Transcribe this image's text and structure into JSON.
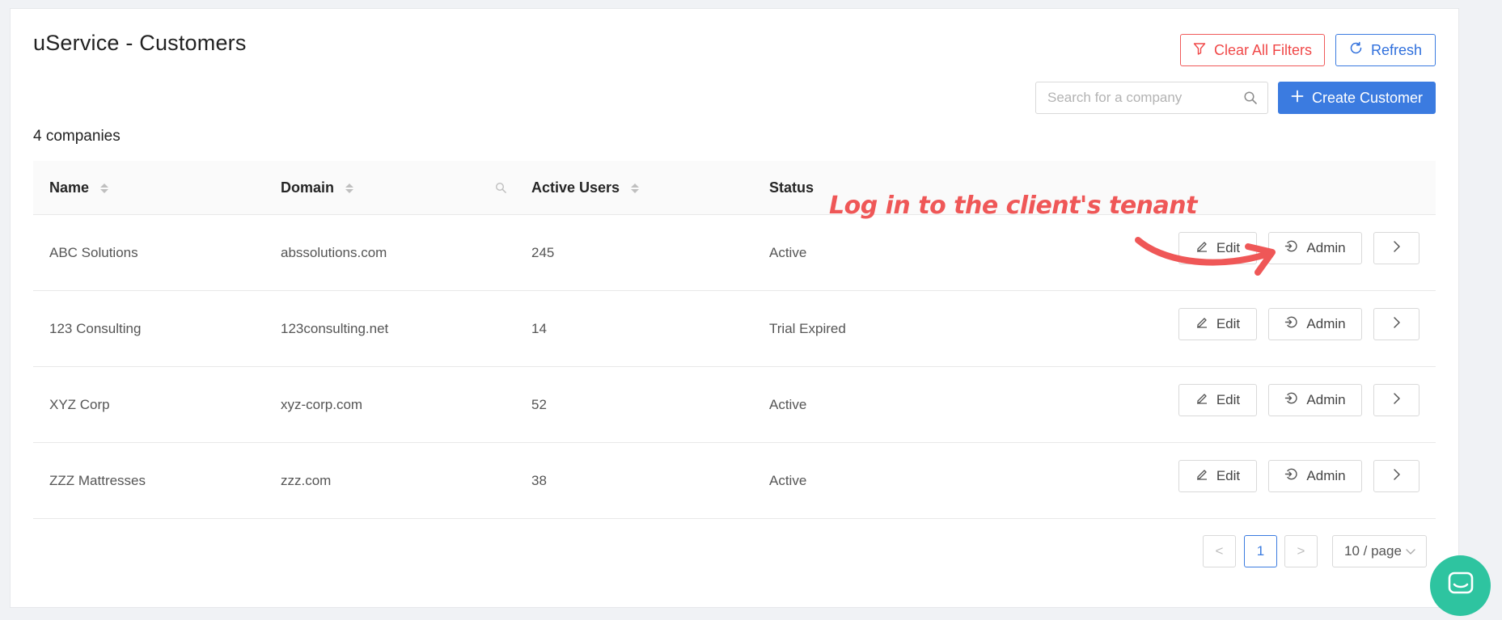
{
  "page": {
    "title": "uService - Customers"
  },
  "toolbar": {
    "clear_filters_label": "Clear All Filters",
    "refresh_label": "Refresh",
    "create_label": "Create Customer",
    "search_placeholder": "Search for a company"
  },
  "summary": {
    "count_label": "4 companies"
  },
  "table": {
    "columns": [
      {
        "label": "Name",
        "sortable": true
      },
      {
        "label": "Domain",
        "sortable": true,
        "filterable": true
      },
      {
        "label": "Active Users",
        "sortable": true
      },
      {
        "label": "Status",
        "sortable": false
      }
    ],
    "rows": [
      {
        "name": "ABC Solutions",
        "domain": "abssolutions.com",
        "active_users": "245",
        "status": "Active"
      },
      {
        "name": "123 Consulting",
        "domain": "123consulting.net",
        "active_users": "14",
        "status": "Trial Expired"
      },
      {
        "name": "XYZ Corp",
        "domain": "xyz-corp.com",
        "active_users": "52",
        "status": "Active"
      },
      {
        "name": "ZZZ Mattresses",
        "domain": "zzz.com",
        "active_users": "38",
        "status": "Active"
      }
    ],
    "row_actions": {
      "edit_label": "Edit",
      "admin_label": "Admin",
      "next_label": ">"
    }
  },
  "pagination": {
    "prev_label": "<",
    "current_page": "1",
    "next_label": ">",
    "page_size_label": "10 / page"
  },
  "annotation": {
    "text": "Log in to the client's tenant",
    "color": "#ef5757"
  },
  "colors": {
    "primary": "#3b7be0",
    "danger": "#f04848",
    "chat": "#2ec4a0"
  },
  "icons": {
    "clear_filters": "filter-icon",
    "refresh": "refresh-icon",
    "create": "plus-icon",
    "search": "search-icon",
    "edit": "pencil-icon",
    "admin": "login-icon",
    "next": "chevron-right-icon",
    "chat": "chat-icon"
  }
}
